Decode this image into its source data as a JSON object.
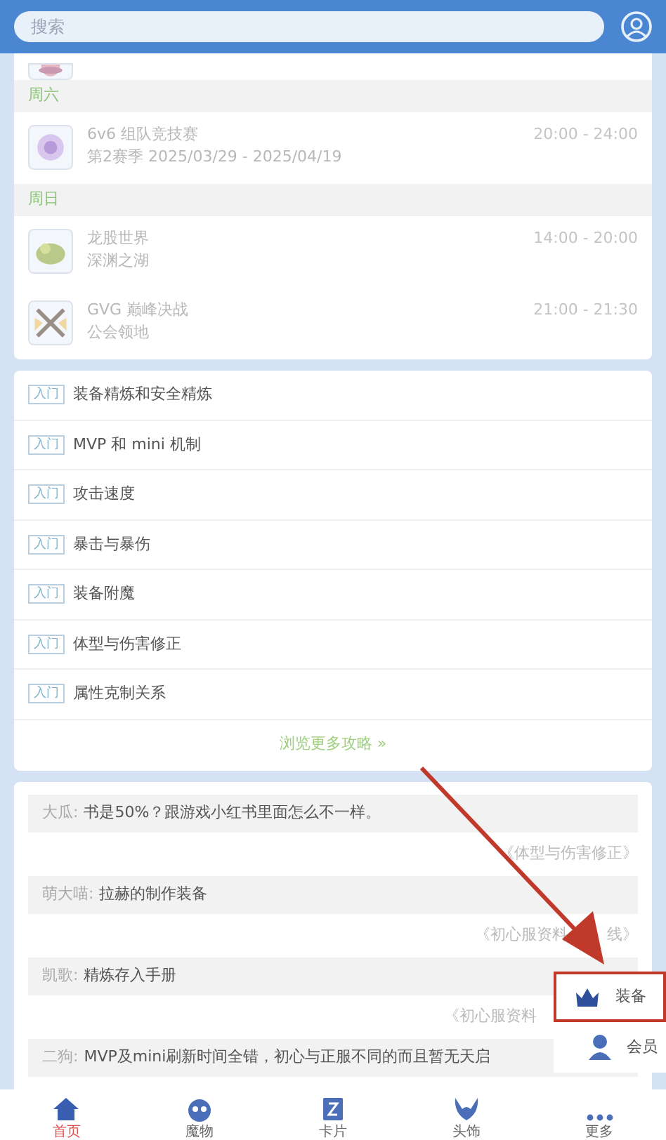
{
  "search": {
    "placeholder": "搜索"
  },
  "events": {
    "days": [
      {
        "label": "周六",
        "items": [
          {
            "title": "6v6 组队竞技赛",
            "subtitle": "第2赛季 2025/03/29 - 2025/04/19",
            "time": "20:00 - 24:00",
            "kind": "orb"
          }
        ]
      },
      {
        "label": "周日",
        "items": [
          {
            "title": "龙股世界",
            "subtitle": "深渊之湖",
            "time": "14:00 - 20:00",
            "kind": "dragon"
          },
          {
            "title": "GVG 巅峰决战",
            "subtitle": "公会领地",
            "time": "21:00 - 21:30",
            "kind": "swords"
          }
        ]
      }
    ]
  },
  "guides": {
    "items": [
      {
        "tag": "入门",
        "title": "装备精炼和安全精炼"
      },
      {
        "tag": "入门",
        "title": "MVP 和 mini 机制"
      },
      {
        "tag": "入门",
        "title": "攻击速度"
      },
      {
        "tag": "入门",
        "title": "暴击与暴伤"
      },
      {
        "tag": "入门",
        "title": "装备附魔"
      },
      {
        "tag": "入门",
        "title": "体型与伤害修正"
      },
      {
        "tag": "入门",
        "title": "属性克制关系"
      }
    ],
    "more_link": "浏览更多攻略 »"
  },
  "comments": [
    {
      "author": "大瓜:",
      "text": "书是50%？跟游戏小红书里面怎么不一样。",
      "source": "《体型与伤害修正》"
    },
    {
      "author": "萌大喵:",
      "text": "拉赫的制作装备",
      "source": "《初心服资料",
      "source_end": "线》"
    },
    {
      "author": "凯歌:",
      "text": "精炼存入手册",
      "source": "《初心服资料"
    },
    {
      "author": "二狗:",
      "text": "MVP及mini刷新时间全错，初心与正服不同的而且暂无天启"
    }
  ],
  "popup_menu": [
    {
      "label": "装备",
      "kind": "equipment",
      "highlighted": true
    },
    {
      "label": "会员",
      "kind": "member",
      "highlighted": false
    }
  ],
  "bottom_nav": [
    {
      "label": "首页",
      "kind": "home",
      "selected": true
    },
    {
      "label": "魔物",
      "kind": "monster",
      "selected": false
    },
    {
      "label": "卡片",
      "kind": "card",
      "selected": false
    },
    {
      "label": "头饰",
      "kind": "headgear",
      "selected": false
    },
    {
      "label": "更多",
      "kind": "more",
      "selected": false
    }
  ]
}
